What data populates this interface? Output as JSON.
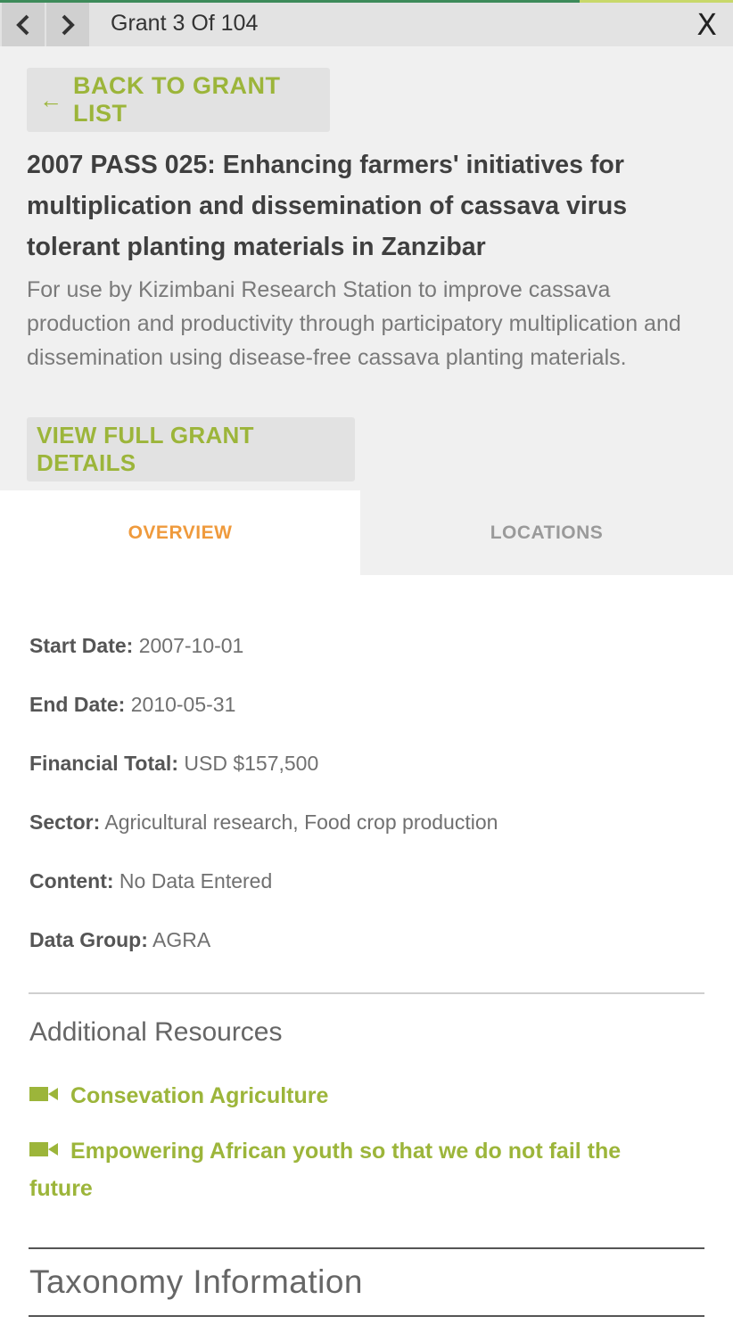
{
  "topbar": {
    "counter": "Grant 3 Of 104",
    "close_label": "X"
  },
  "header": {
    "back_label": "BACK TO GRANT LIST",
    "title": "2007 PASS 025: Enhancing farmers' initiatives for multiplication and dissemination of cassava virus tolerant planting materials in Zanzibar",
    "description": "For use by Kizimbani Research Station to improve cassava production and productivity through participatory multiplication and dissemination using disease-free cassava planting materials.",
    "details_label": "VIEW FULL GRANT DETAILS"
  },
  "tabs": {
    "overview": "OVERVIEW",
    "locations": "LOCATIONS"
  },
  "overview": {
    "start_date": {
      "label": "Start Date:",
      "value": "2007-10-01"
    },
    "end_date": {
      "label": "End Date:",
      "value": "2010-05-31"
    },
    "financial_total": {
      "label": "Financial Total:",
      "value": "USD $157,500"
    },
    "sector": {
      "label": "Sector:",
      "value": "Agricultural research, Food crop production"
    },
    "content": {
      "label": "Content:",
      "value": "No Data Entered"
    },
    "data_group": {
      "label": "Data Group:",
      "value": "AGRA"
    }
  },
  "resources": {
    "heading": "Additional Resources",
    "items": [
      {
        "icon": "video-camera-icon",
        "label": "Consevation Agriculture"
      },
      {
        "icon": "video-camera-icon",
        "label": "Empowering African youth so that we do not fail the future"
      }
    ]
  },
  "taxonomy": {
    "heading": "Taxonomy Information"
  },
  "colors": {
    "accent_green": "#9cb53a",
    "active_tab_orange": "#ef9a3c",
    "progress_green": "#3d8b5a"
  }
}
